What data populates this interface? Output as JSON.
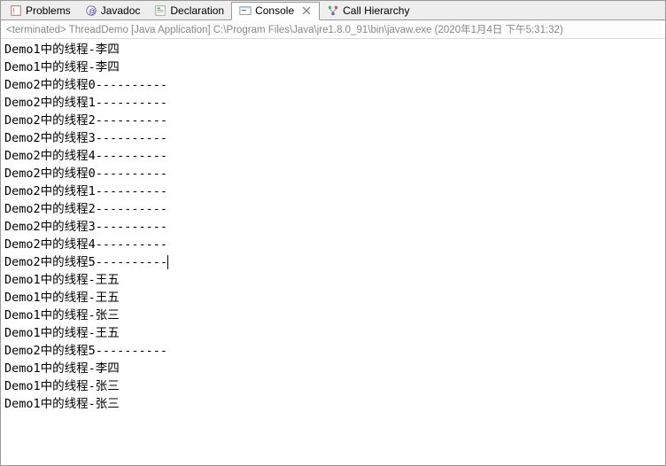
{
  "tabs": [
    {
      "label": "Problems",
      "icon": "problems-icon",
      "active": false
    },
    {
      "label": "Javadoc",
      "icon": "javadoc-icon",
      "active": false
    },
    {
      "label": "Declaration",
      "icon": "declaration-icon",
      "active": false
    },
    {
      "label": "Console",
      "icon": "console-icon",
      "active": true,
      "closable": true
    },
    {
      "label": "Call Hierarchy",
      "icon": "call-hierarchy-icon",
      "active": false
    }
  ],
  "status": "<terminated> ThreadDemo [Java Application] C:\\Program Files\\Java\\jre1.8.0_91\\bin\\javaw.exe (2020年1月4日 下午5:31:32)",
  "lines": [
    "Demo1中的线程-李四",
    "Demo1中的线程-李四",
    "Demo2中的线程0----------",
    "Demo2中的线程1----------",
    "Demo2中的线程2----------",
    "Demo2中的线程3----------",
    "Demo2中的线程4----------",
    "Demo2中的线程0----------",
    "Demo2中的线程1----------",
    "Demo2中的线程2----------",
    "Demo2中的线程3----------",
    "Demo2中的线程4----------",
    "Demo2中的线程5----------",
    "Demo1中的线程-王五",
    "Demo1中的线程-王五",
    "Demo1中的线程-张三",
    "Demo1中的线程-王五",
    "Demo2中的线程5----------",
    "Demo1中的线程-李四",
    "Demo1中的线程-张三",
    "Demo1中的线程-张三"
  ],
  "cursor_line": 12
}
